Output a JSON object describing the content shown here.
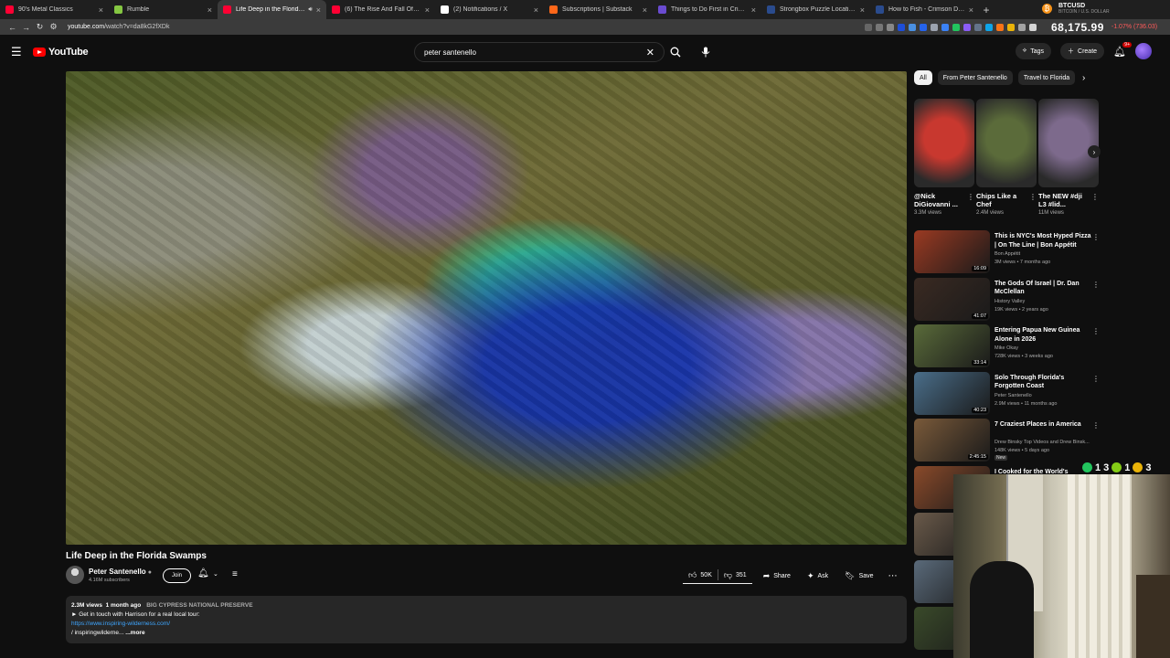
{
  "browser": {
    "tabs": [
      {
        "title": "90's Metal Classics",
        "color": "#ff0033"
      },
      {
        "title": "Rumble",
        "color": "#85c742"
      },
      {
        "title": "Life Deep in the Florida Swamps",
        "color": "#ff0033",
        "active": true
      },
      {
        "title": "(6) The Rise And Fall Of Southe",
        "color": "#ff0033"
      },
      {
        "title": "(2) Notifications / X",
        "color": "#ffffff"
      },
      {
        "title": "Subscriptions | Substack",
        "color": "#ff6719"
      },
      {
        "title": "Things to Do First in Crimson D",
        "color": "#6a4bd0"
      },
      {
        "title": "Strongbox Puzzle Locations an",
        "color": "#2a4b8d"
      },
      {
        "title": "How to Fish - Crimson Desert G",
        "color": "#2a4b8d"
      }
    ],
    "url_host": "youtube.com",
    "url_path": "/watch?v=da8kG2fXDk"
  },
  "ticker": {
    "symbol": "BTCUSD",
    "subtitle": "BITCOIN / U.S. DOLLAR",
    "price": "68,175.99",
    "change": "-1.07% (736.03)"
  },
  "masthead": {
    "logo": "YouTube",
    "search_value": "peter santenello",
    "tags_label": "Tags",
    "create_label": "Create",
    "notif_count": "9+"
  },
  "video": {
    "title": "Life Deep in the Florida Swamps",
    "channel": "Peter Santenello",
    "subscribers": "4.16M subscribers",
    "join_label": "Join",
    "likes": "50K",
    "dislikes": "351",
    "share_label": "Share",
    "ask_label": "Ask",
    "save_label": "Save"
  },
  "description": {
    "views": "2.3M views",
    "age": "1 month ago",
    "tag": "BIG CYPRESS NATIONAL PRESERVE",
    "line1": "► Get in touch with Harrison for a real local tour:",
    "link": "https://www.inspiring-wilderness.com/",
    "line3": "/ inspiringwilderne...",
    "more": "...more"
  },
  "sidebar": {
    "chips": [
      "All",
      "From Peter Santenello",
      "Travel to Florida"
    ],
    "shorts": [
      {
        "title": "@Nick DiGiovanni ...",
        "views": "3.3M views",
        "color": "#c8382f"
      },
      {
        "title": "Chips Like a Chef",
        "views": "2.4M views",
        "color": "#5b6b3a"
      },
      {
        "title": "The NEW #dji L3 #lid...",
        "views": "11M views",
        "color": "#7d6a8c"
      }
    ],
    "recs": [
      {
        "title": "This is NYC's Most Hyped Pizza | On The Line | Bon Appétit",
        "channel": "Bon Appétit",
        "meta": "3M views • 7 months ago",
        "duration": "16:09",
        "color": "#9b3a22"
      },
      {
        "title": "The Gods Of Israel | Dr. Dan McClellan",
        "channel": "History Valley",
        "meta": "19K views • 2 years ago",
        "duration": "41:07",
        "color": "#3a2a22"
      },
      {
        "title": "Entering Papua New Guinea Alone in 2026",
        "channel": "Mike Okay",
        "meta": "728K views • 3 weeks ago",
        "duration": "33:14",
        "color": "#5a6b3a"
      },
      {
        "title": "Solo Through Florida's Forgotten Coast",
        "channel": "Peter Santenello",
        "meta": "2.9M views • 11 months ago",
        "duration": "40:23",
        "color": "#4a6e8a"
      },
      {
        "title": "7 Craziest Places in America",
        "channel": "Drew Binsky Top Videos and Drew Binsk...",
        "meta": "148K views • 5 days ago",
        "duration": "2:45:15",
        "color": "#7a5a3a",
        "badge": "New"
      },
      {
        "title": "I Cooked for the World's",
        "channel": "",
        "meta": "",
        "duration": "",
        "color": "#8a4a2a"
      },
      {
        "title": "",
        "channel": "",
        "meta": "",
        "duration": "",
        "color": "#6a5a4a"
      },
      {
        "title": "",
        "channel": "",
        "meta": "",
        "duration": "",
        "color": "#5a6a7a"
      },
      {
        "title": "",
        "channel": "",
        "meta": "",
        "duration": "",
        "color": "#3a4a2a"
      }
    ]
  },
  "overlay": {
    "counters": [
      "1",
      "3",
      "1",
      "3"
    ]
  }
}
